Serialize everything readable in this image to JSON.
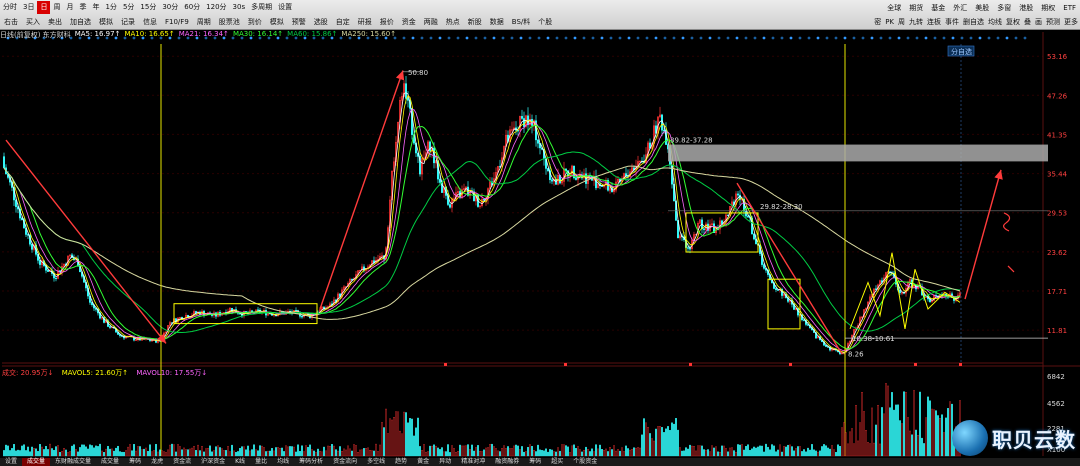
{
  "toolbar": {
    "row1": [
      "分时",
      "3日",
      "日",
      "周",
      "月",
      "季",
      "年",
      "1分",
      "5分",
      "15分",
      "30分",
      "60分",
      "120分",
      "30s",
      "多周期",
      "设置"
    ],
    "active_period": "日",
    "row2": [
      "右击",
      "买入",
      "卖出",
      "加自选",
      "模拟",
      "记录",
      "信息",
      "F10/F9",
      "周期",
      "股票池",
      "到价",
      "模拟",
      "预警",
      "选股",
      "自定",
      "研报",
      "报价",
      "资金",
      "两融",
      "热点",
      "新股",
      "数据",
      "BS/料",
      "个股"
    ],
    "right_buttons": [
      "全球",
      "期货",
      "基金",
      "外汇",
      "美股",
      "多窗",
      "港股",
      "期权",
      "ETF"
    ],
    "right_tabs": [
      "密",
      "PK",
      "周",
      "九转",
      "连板",
      "事件",
      "删自选",
      "均线",
      "复权",
      "叠",
      "画",
      "预测",
      "更多"
    ]
  },
  "info_bar": {
    "mode": "日线(前复权) 东方财科",
    "ma5": "MA5: 16.97↑",
    "ma10": "MA10: 16.65↑",
    "ma21": "MA21: 16.34↑",
    "ma30": "MA30: 16.14↑",
    "ma60": "MA60: 15.86↑",
    "ma250": "MA250: 15.60↑"
  },
  "axis": {
    "price_ticks": [
      "53.16",
      "47.26",
      "41.35",
      "35.44",
      "29.53",
      "23.62",
      "17.71",
      "11.81"
    ],
    "volume_ticks": [
      "6842",
      "4562",
      "2281",
      "X100"
    ]
  },
  "annotations": {
    "peak_label": "50.80",
    "resistance_label": "39.82-37.28",
    "mid_label": "29.82-28.30",
    "low_range_label": "10.38-10.61",
    "low_label": "8.26",
    "marker": "分自选"
  },
  "volume_info": {
    "main": "成交: 20.95万↓",
    "mavol5": "MAVOL5: 21.60万↑",
    "mavol10": "MAVOL10: 17.55万↓"
  },
  "bottom_tabs": [
    "设置",
    "成交量",
    "东财融成交量",
    "成交量",
    "筹码",
    "龙虎",
    "资金流",
    "沪深资金",
    "K线",
    "量比",
    "均线",
    "筹码分析",
    "资金流向",
    "多空线",
    "趋势",
    "黄金",
    "异动",
    "精准对冲",
    "融资融券",
    "筹码",
    "超买",
    "个股资金"
  ],
  "watermark": "职贝云数",
  "chart_data": {
    "type": "candlestick",
    "y_range": [
      7,
      55
    ],
    "volume_range": [
      0,
      7000
    ],
    "note_points": {
      "start_high": 40.5,
      "first_low": 10.2,
      "consolidation": [
        13.2,
        15.5
      ],
      "peak": 50.8,
      "resistance_zone": [
        37.28,
        39.82
      ],
      "mid_zone": [
        28.3,
        29.82
      ],
      "bottom": 8.26,
      "recent": 16.97
    }
  },
  "colors": {
    "up": "#ff3333",
    "down": "#33ffff",
    "ma5": "#ffffff",
    "ma10": "#ffff00",
    "ma21": "#ff66ff",
    "ma30": "#33ff33",
    "ma60": "#00cc44",
    "ma250": "#d8d8a0",
    "box": "#ffff00",
    "trend": "#ff3b3b",
    "zone": "#aaaaaa"
  }
}
